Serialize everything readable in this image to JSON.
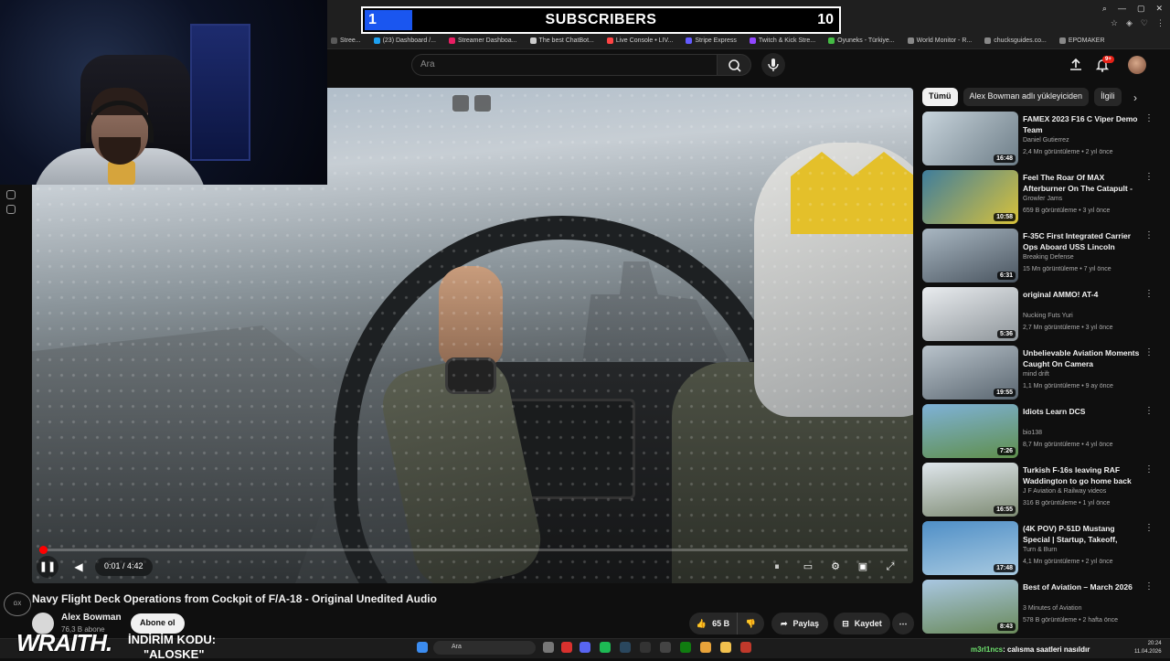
{
  "overlay": {
    "subscribers_current": "1",
    "subscribers_title": "SUBSCRIBERS",
    "subscribers_goal": "10",
    "progress": 0.1
  },
  "bookmarks": [
    {
      "label": "Stree...",
      "color": "#5a5a5a"
    },
    {
      "label": "(23) Dashboard /...",
      "color": "#1da1f2"
    },
    {
      "label": "Streamer Dashboa...",
      "color": "#e91e63"
    },
    {
      "label": "The best ChatBot...",
      "color": "#cccccc"
    },
    {
      "label": "Live Console • LIV...",
      "color": "#ff4444"
    },
    {
      "label": "Stripe Express",
      "color": "#635bff"
    },
    {
      "label": "Twitch & Kick Stre...",
      "color": "#9146ff"
    },
    {
      "label": "Oyuneks - Türkiye...",
      "color": "#44bb44"
    },
    {
      "label": "World Monitor - R...",
      "color": "#888888"
    },
    {
      "label": "chucksguides.co...",
      "color": "#888888"
    },
    {
      "label": "EPOMAKER",
      "color": "#888888"
    }
  ],
  "header": {
    "search_placeholder": "Ara",
    "notification_count": "9+"
  },
  "player": {
    "current_time": "0:01",
    "duration": "4:42",
    "progress": 0.004
  },
  "video": {
    "title": "Navy Flight Deck Operations from Cockpit of F/A-18 - Original Unedited Audio",
    "channel": "Alex Bowman",
    "subscribers": "76,3 B abone",
    "subscribe_label": "Abone ol",
    "likes": "65 B",
    "share_label": "Paylaş",
    "save_label": "Kaydet"
  },
  "chips": [
    "Tümü",
    "Alex Bowman adlı yükleyiciden",
    "İlgili"
  ],
  "recommendations": [
    {
      "title": "FAMEX 2023 F16 C Viper Demo Team",
      "channel": "Daniel Gutierrez",
      "meta": "2,4 Mn görüntüleme • 2 yıl önce",
      "duration": "16:48",
      "thumb": "linear-gradient(135deg,#c8d4dc,#6e7e88)"
    },
    {
      "title": "Feel The Roar Of MAX Afterburner On The Catapult - ...",
      "channel": "Growler Jams",
      "meta": "659 B görüntüleme • 3 yıl önce",
      "duration": "10:58",
      "thumb": "linear-gradient(135deg,#3f7d9c,#d8c23a)"
    },
    {
      "title": "F-35C First Integrated Carrier Ops Aboard USS Lincoln",
      "channel": "Breaking Defense",
      "meta": "15 Mn görüntüleme • 7 yıl önce",
      "duration": "6:31",
      "thumb": "linear-gradient(160deg,#a9b7c2,#4a5560)"
    },
    {
      "title": "original AMMO! AT-4",
      "channel": "Nucking Futs Yuri",
      "meta": "2,7 Mn görüntüleme • 3 yıl önce",
      "duration": "5:36",
      "thumb": "linear-gradient(160deg,#e9ecef,#8f969b)"
    },
    {
      "title": "Unbelievable Aviation Moments Caught On Camera",
      "channel": "mind drift",
      "meta": "1,1 Mn görüntüleme • 9 ay önce",
      "duration": "19:55",
      "thumb": "linear-gradient(160deg,#b9c3cb,#5a6670)"
    },
    {
      "title": "Idiots Learn DCS",
      "channel": "bio138",
      "meta": "8,7 Mn görüntüleme • 4 yıl önce",
      "duration": "7:26",
      "thumb": "linear-gradient(170deg,#7fb2d8,#5f8f4c)"
    },
    {
      "title": "Turkish F-16s leaving RAF Waddington to go home back t...",
      "channel": "J F Aviation & Railway videos",
      "meta": "316 B görüntüleme • 1 yıl önce",
      "duration": "16:55",
      "thumb": "linear-gradient(170deg,#dfe6ec,#7e8b73)"
    },
    {
      "title": "(4K POV) P-51D Mustang Special | Startup, Takeoff, Low...",
      "channel": "Turn & Burn",
      "meta": "4,1 Mn görüntüleme • 2 yıl önce",
      "duration": "17:48",
      "thumb": "linear-gradient(170deg,#4f8fc7,#a7c9e0)"
    },
    {
      "title": "Best of Aviation – March 2026",
      "channel": "3 Minutes of Aviation",
      "meta": "578 B görüntüleme • 2 hafta önce",
      "duration": "8:43",
      "thumb": "linear-gradient(170deg,#a9c7e2,#6a8a5a)"
    }
  ],
  "stream": {
    "brand": "WRAITH.",
    "promo_line1": "İNDİRİM KODU:",
    "promo_line2": "\"ALOSKE\"",
    "chat_user": "m3rl1ncs",
    "chat_message": ": calısma saatleri nasıldır"
  },
  "taskbar": {
    "search_placeholder": "Ara",
    "time": "20:24",
    "date": "11.04.2026"
  }
}
